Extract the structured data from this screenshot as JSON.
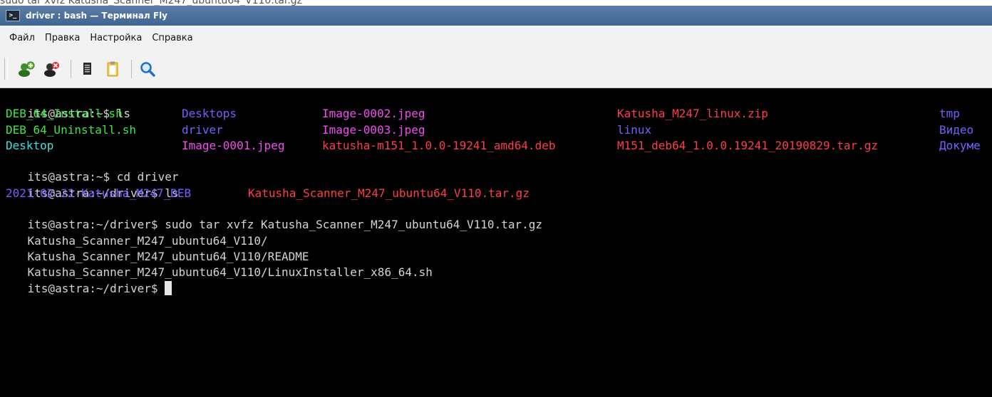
{
  "background_text": "sudo tar xvfz Katusha_Scanner_M247_ubuntu64_V110.tar.gz",
  "window": {
    "title": "driver : bash — Терминал Fly",
    "icon": "terminal-icon"
  },
  "menu": {
    "file": "Файл",
    "edit": "Правка",
    "settings": "Настройка",
    "help": "Справка"
  },
  "toolbar": {
    "buttons": [
      "new-session-icon",
      "close-session-icon",
      "copy-icon",
      "paste-icon",
      "search-icon"
    ]
  },
  "terminal": {
    "prompt_home": "its@astra:~$ ",
    "prompt_driver": "its@astra:~/driver$ ",
    "cmd_ls": "ls",
    "cmd_cd": "cd driver",
    "cmd_tar": "sudo tar xvfz Katusha_Scanner_M247_ubuntu64_V110.tar.gz",
    "ls_home": {
      "row1": [
        "DEB_64_Install.sh",
        "Desktops",
        "Image-0002.jpeg",
        "Katusha_M247_linux.zip",
        "tmp"
      ],
      "row2": [
        "DEB_64_Uninstall.sh",
        "driver",
        "Image-0003.jpeg",
        "linux",
        "Видео"
      ],
      "row3": [
        "Desktop",
        "Image-0001.jpeg",
        "katusha-m151_1.0.0-19241_amd64.deb",
        "M151_deb64_1.0.0.19241_20190829.tar.gz",
        "Докуме"
      ]
    },
    "ls_driver": [
      "2021-02-22-Katusha_M247_DEB",
      "Katusha_Scanner_M247_ubuntu64_V110.tar.gz"
    ],
    "tar_output": [
      "Katusha_Scanner_M247_ubuntu64_V110/",
      "Katusha_Scanner_M247_ubuntu64_V110/README",
      "Katusha_Scanner_M247_ubuntu64_V110/LinuxInstaller_x86_64.sh"
    ]
  },
  "colors": {
    "green": "#3ee64a",
    "blue": "#6f63ff",
    "cyan": "#3fe0e0",
    "magenta": "#f04cf0",
    "red": "#ff3d4a"
  }
}
